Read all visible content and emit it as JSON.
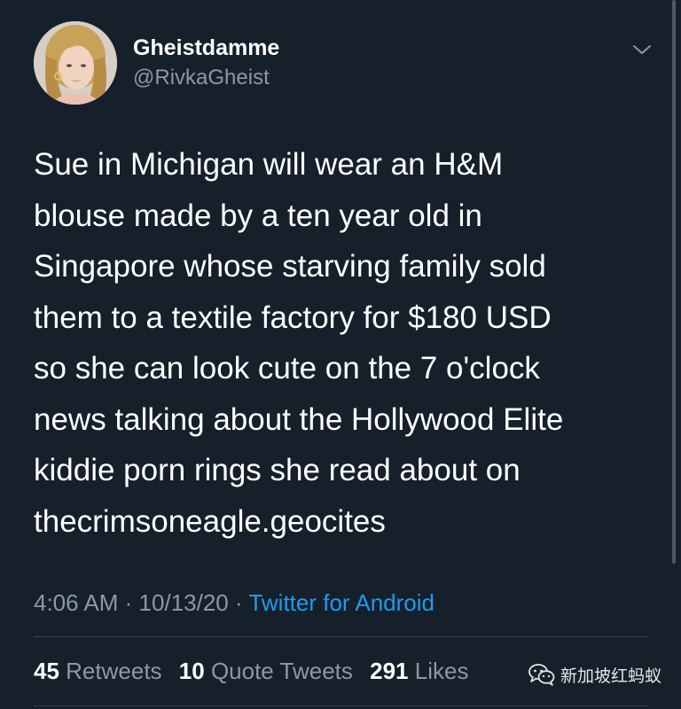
{
  "user": {
    "display_name": "Gheistdamme",
    "handle": "@RivkaGheist",
    "avatar_icon": "avatar-photo"
  },
  "header": {
    "more_icon": "chevron-down-icon"
  },
  "tweet": {
    "text": "Sue in Michigan will wear an H&M\nblouse made by a ten year old in\nSingapore whose starving family sold\nthem to a textile factory for $180 USD\nso she can look cute on the 7 o'clock\nnews talking about the Hollywood Elite\nkiddie porn rings she read about on\nthecrimsoneagle.geocites",
    "time": "4:06 AM",
    "date": "10/13/20",
    "separator": "·",
    "source": "Twitter for Android"
  },
  "stats": {
    "retweets_count": "45",
    "retweets_label": "Retweets",
    "quotes_count": "10",
    "quotes_label": "Quote Tweets",
    "likes_count": "291",
    "likes_label": "Likes"
  },
  "watermark": {
    "text": "新加坡红蚂蚁",
    "icon": "wechat-icon"
  },
  "colors": {
    "background": "#15202b",
    "primary_text": "#ffffff",
    "secondary_text": "#8b98a5",
    "link": "#1d9bf0",
    "divider": "#38444d"
  }
}
